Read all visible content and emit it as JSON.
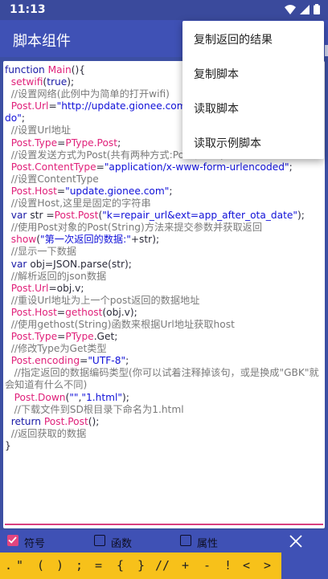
{
  "status_bar": {
    "time": "11:13"
  },
  "app_bar": {
    "title": "脚本组件"
  },
  "menu": {
    "items": [
      "复制返回的结果",
      "复制脚本",
      "读取脚本",
      "读取示例脚本"
    ]
  },
  "tabs": [
    {
      "label": "符号",
      "checked": true
    },
    {
      "label": "函数",
      "checked": false
    },
    {
      "label": "属性",
      "checked": false
    }
  ],
  "symbol_keys": [
    ".",
    "\"",
    "(",
    ")",
    ";",
    "=",
    "{",
    "}",
    "//",
    "+",
    "-",
    "!",
    "<",
    ">"
  ],
  "colors": {
    "appbar": "#3f51b5",
    "accent": "#e2457f",
    "keys_bg": "#f7c11a"
  }
}
